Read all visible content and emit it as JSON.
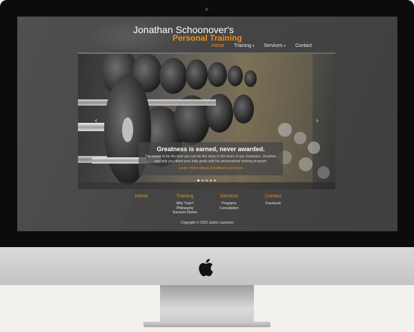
{
  "site": {
    "title": "Jonathan Schoonover's",
    "subtitle": "Personal Training"
  },
  "nav": {
    "items": [
      {
        "label": "Home",
        "active": true,
        "dropdown": false
      },
      {
        "label": "Training",
        "active": false,
        "dropdown": true
      },
      {
        "label": "Services",
        "active": false,
        "dropdown": true
      },
      {
        "label": "Contact",
        "active": false,
        "dropdown": false
      }
    ],
    "caret": "▾"
  },
  "hero": {
    "prev_arrow": "‹",
    "next_arrow": "›",
    "caption_title": "Greatness is earned, never awarded.",
    "caption_text": "The desire to be the best you can be lies deep in the heart of any champion. Jonathan can help you attain your lofty goals with his personalized training program.",
    "caption_link": "Learn more about Jonathan's services",
    "slide_count": 5,
    "active_slide": 1
  },
  "footer": {
    "columns": [
      {
        "heading": "Home",
        "links": []
      },
      {
        "heading": "Training",
        "links": [
          "Why Train?",
          "Philosophy",
          "Success Stories"
        ]
      },
      {
        "heading": "Services",
        "links": [
          "Programs",
          "Consultation"
        ]
      },
      {
        "heading": "Contact",
        "links": [
          "Facebook"
        ]
      }
    ],
    "copyright": "Copyright © 2015 Justin Laurisano"
  },
  "colors": {
    "accent": "#e7901f",
    "screen_bg": "#454545",
    "bezel": "#0c0c0c"
  },
  "icons": {
    "device_logo": "apple-logo-icon"
  }
}
